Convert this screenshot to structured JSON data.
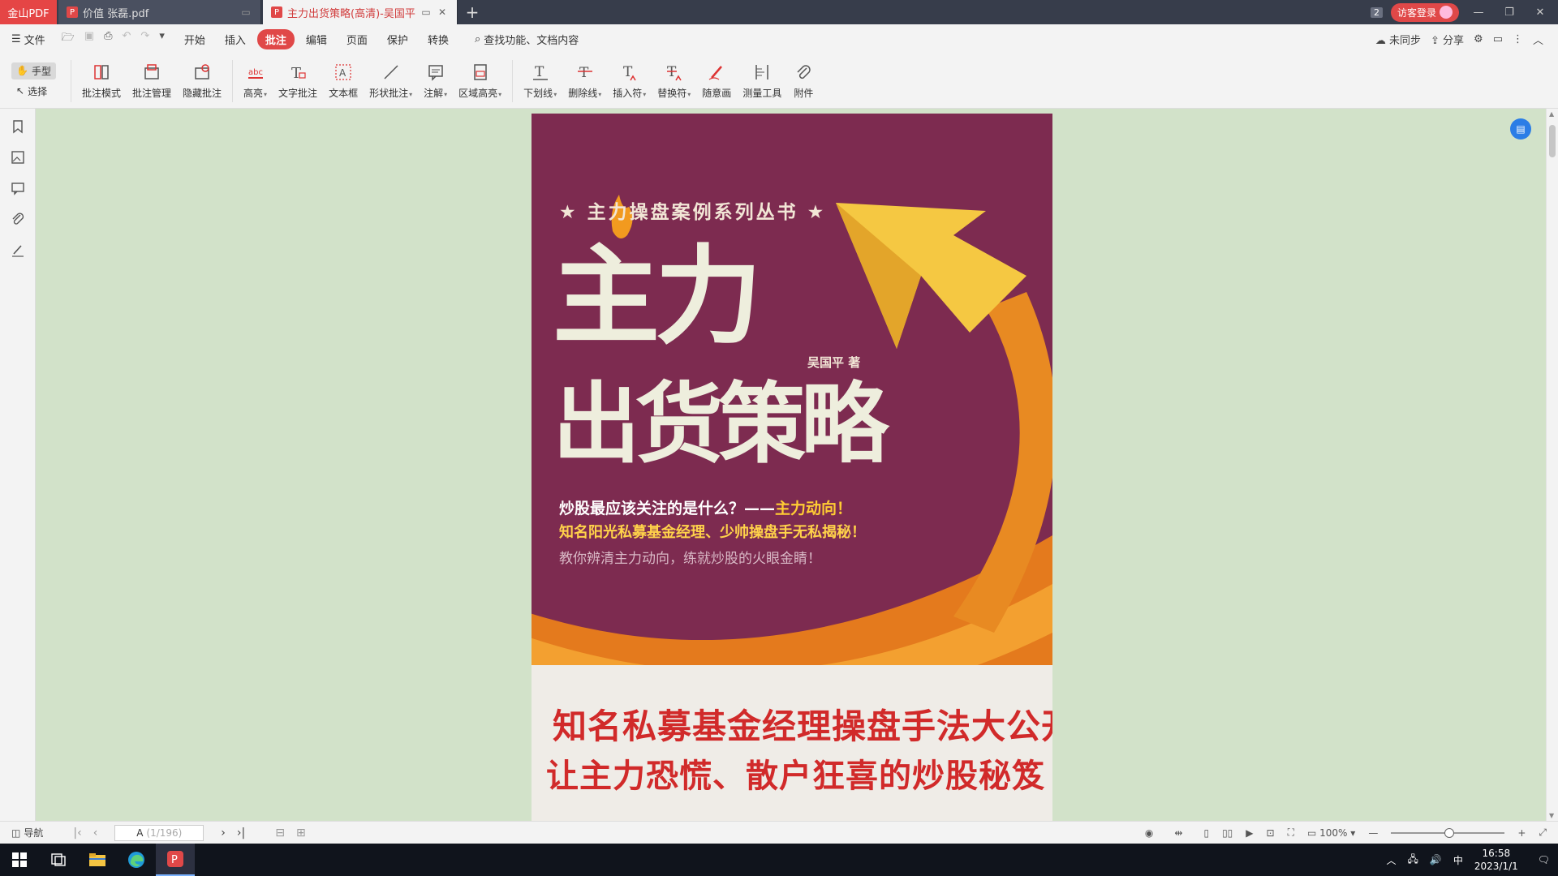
{
  "app": {
    "brand": "金山PDF"
  },
  "tabs": [
    {
      "label": "价值 张磊.pdf",
      "active": false
    },
    {
      "label": "主力出货策略(高清)-吴国平.pdf",
      "active": true
    }
  ],
  "titlebar": {
    "badge": "2",
    "login": "访客登录"
  },
  "menu": {
    "file": "文件",
    "items": [
      "开始",
      "插入",
      "批注",
      "编辑",
      "页面",
      "保护",
      "转换"
    ],
    "active": "批注",
    "search": "查找功能、文档内容",
    "sync": "未同步",
    "share": "分享"
  },
  "ribbon": {
    "hand": "手型",
    "select": "选择",
    "buttons": [
      "批注模式",
      "批注管理",
      "隐藏批注",
      "高亮",
      "文字批注",
      "文本框",
      "形状批注",
      "注解",
      "区域高亮",
      "下划线",
      "删除线",
      "插入符",
      "替换符",
      "随意画",
      "测量工具",
      "附件"
    ]
  },
  "document": {
    "series": "★ 主力操盘案例系列丛书 ★",
    "title_line1": "主力",
    "title_line2": "出货策略",
    "author": "吴国平 著",
    "tagline1_a": "炒股最应该关注的是什么？——",
    "tagline1_b": "主力动向！",
    "tagline2": "知名阳光私募基金经理、少帅操盘手无私揭秘！",
    "tagline3": "教你辨清主力动向，练就炒股的火眼金睛！",
    "red_line1": "知名私募基金经理操盘手法大公开",
    "red_line2": "让主力恐慌、散户狂喜的炒股秘笈"
  },
  "status": {
    "nav": "导航",
    "page_current": "A",
    "page_total": "(1/196)",
    "zoom": "100%"
  },
  "taskbar": {
    "ime": "中",
    "time": "16:58",
    "date": "2023/1/1"
  },
  "colors": {
    "accent": "#e04848",
    "doc_bg": "#d2e2c9",
    "cover": "#7d2b50"
  }
}
